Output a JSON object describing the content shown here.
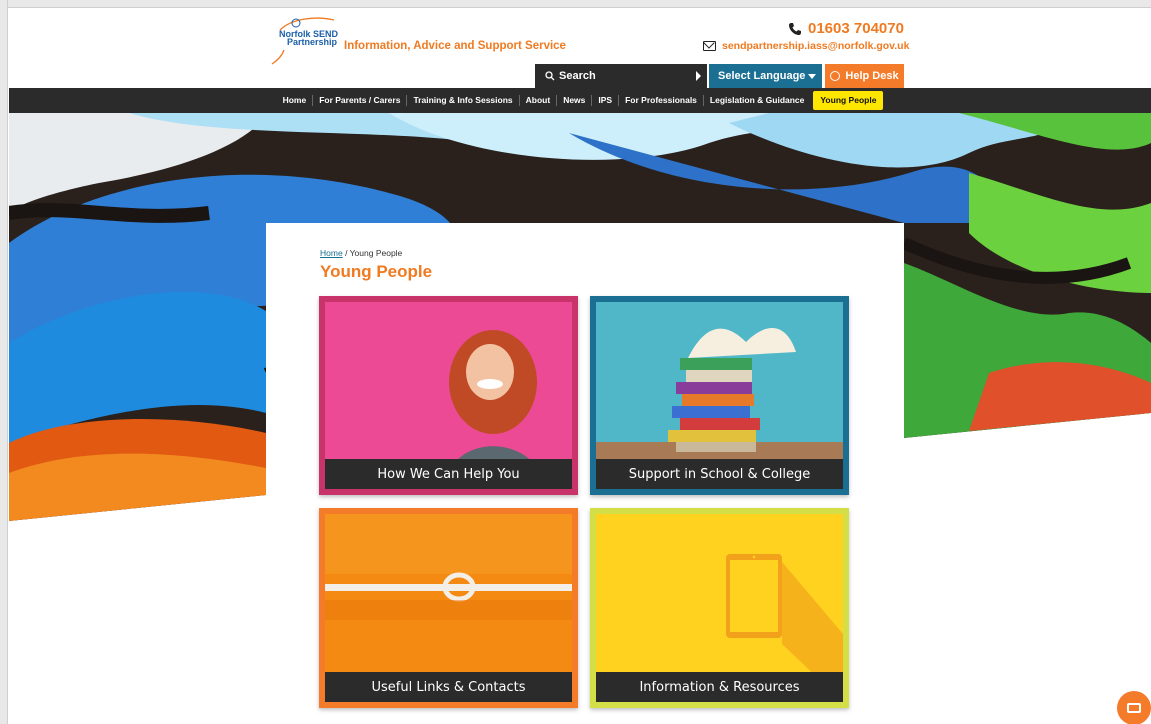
{
  "header": {
    "logo_text_line1": "Norfolk SEND",
    "logo_text_line2": "Partnership",
    "tagline": "Information, Advice and Support Service",
    "phone": "01603 704070",
    "email": "sendpartnership.iass@norfolk.gov.uk",
    "search_label": "Search",
    "language_label": "Select Language",
    "helpdesk_label": "Help Desk"
  },
  "nav": {
    "items": [
      "Home",
      "For Parents / Carers",
      "Training & Info Sessions",
      "About",
      "News",
      "IPS",
      "For Professionals",
      "Legislation & Guidance",
      "Young People"
    ],
    "active": "Young People"
  },
  "breadcrumb": {
    "home": "Home",
    "separator": "/",
    "current": "Young People"
  },
  "page": {
    "title": "Young People"
  },
  "tiles": [
    {
      "label": "How We Can Help You",
      "border_color": "#c8336a"
    },
    {
      "label": "Support in School & College",
      "border_color": "#1a6f92"
    },
    {
      "label": "Useful Links & Contacts",
      "border_color": "#f37b2a"
    },
    {
      "label": "Information & Resources",
      "border_color": "#d4df48"
    }
  ],
  "colors": {
    "brand_orange": "#f07a20",
    "nav_dark": "#2b2b2b",
    "language_blue": "#1a6f92",
    "active_yellow": "#ffe600"
  },
  "icons": {
    "phone": "phone-icon",
    "email": "mail-icon",
    "search": "search-icon",
    "helpdesk": "smiley-icon",
    "chat": "envelope-icon"
  }
}
